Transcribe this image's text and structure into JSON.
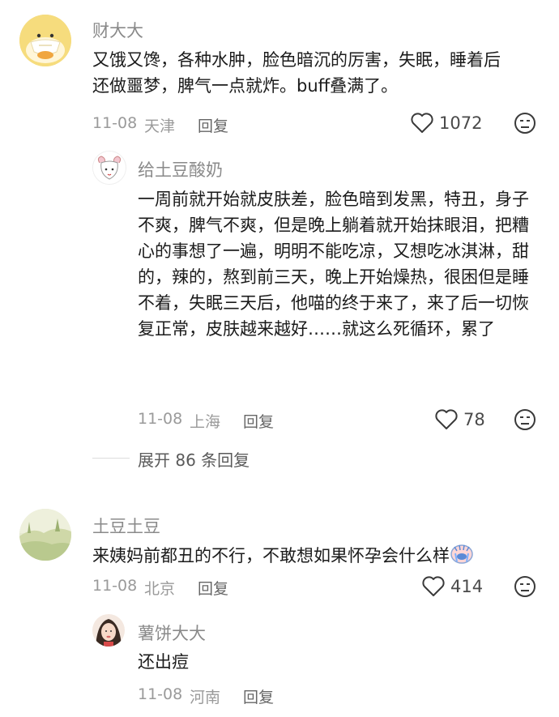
{
  "comments": [
    {
      "name": "财大大",
      "text": "又饿又馋，各种水肿，脸色暗沉的厉害，失眠，睡着后还做噩梦，脾气一点就炸。buff叠满了。",
      "date": "11-08",
      "location": "天津",
      "reply_label": "回复",
      "likes": "1072",
      "replies": [
        {
          "name": "给土豆酸奶",
          "text": "一周前就开始就皮肤差，脸色暗到发黑，特丑，身子不爽，脾气不爽，但是晚上躺着就开始抹眼泪，把糟心的事想了一遍，明明不能吃凉，又想吃冰淇淋，甜的，辣的，熬到前三天，晚上开始燥热，很困但是睡不着，失眠三天后，他喵的终于来了，来了后一切恢复正常，皮肤越来越好……就这么死循环，累了",
          "date": "11-08",
          "location": "上海",
          "reply_label": "回复",
          "likes": "78"
        }
      ],
      "expand_label": "展开 86 条回复"
    },
    {
      "name": "土豆土豆",
      "text": "来姨妈前都丑的不行，不敢想如果怀孕会什么样",
      "date": "11-08",
      "location": "北京",
      "reply_label": "回复",
      "likes": "414",
      "replies": [
        {
          "name": "薯饼大大",
          "text": "还出痘",
          "date": "11-08",
          "location": "河南",
          "reply_label": "回复"
        }
      ]
    }
  ],
  "icons": {
    "like": "heart-outline-icon",
    "dislike": "frown-face-icon",
    "emoji": "crying-face-emoji-icon"
  },
  "colors": {
    "name": "#8a8a8a",
    "meta": "#9a9a9a",
    "text": "#1b1b1b"
  }
}
